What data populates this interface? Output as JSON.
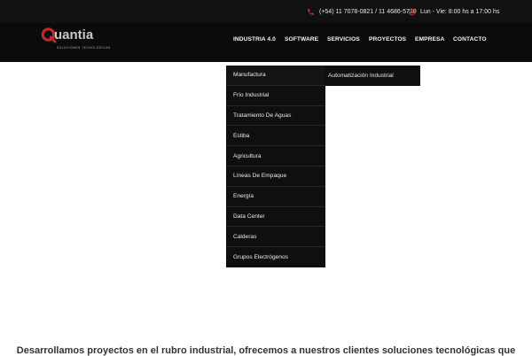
{
  "topbar": {
    "phone": "(+54) 11 7078-0821 / 11 4686-5730",
    "hours": "Lun - Vie: 8:00 hs a 17:00 hs",
    "icon_color": "#e0262b"
  },
  "logo": {
    "name": "Quantia",
    "tagline": "SOLUCIONES TECNOLÓGICAS",
    "color": "#c1272d"
  },
  "nav": {
    "items": [
      "INDUSTRIA 4.0",
      "SOFTWARE",
      "SERVICIOS",
      "PROYECTOS",
      "EMPRESA",
      "CONTACTO"
    ]
  },
  "dropdown": {
    "items": [
      "Manufactura",
      "Frío Industrial",
      "Tratamiento De Aguas",
      "Estiba",
      "Agricultura",
      "Líneas De Empaque",
      "Energía",
      "Data Center",
      "Calderas",
      "Grupos Electrógenos"
    ],
    "submenu": [
      "Automatización Industrial"
    ]
  },
  "body": {
    "intro": "Desarrollamos proyectos en el rubro industrial, ofrecemos a nuestros clientes soluciones tecnológicas que"
  }
}
